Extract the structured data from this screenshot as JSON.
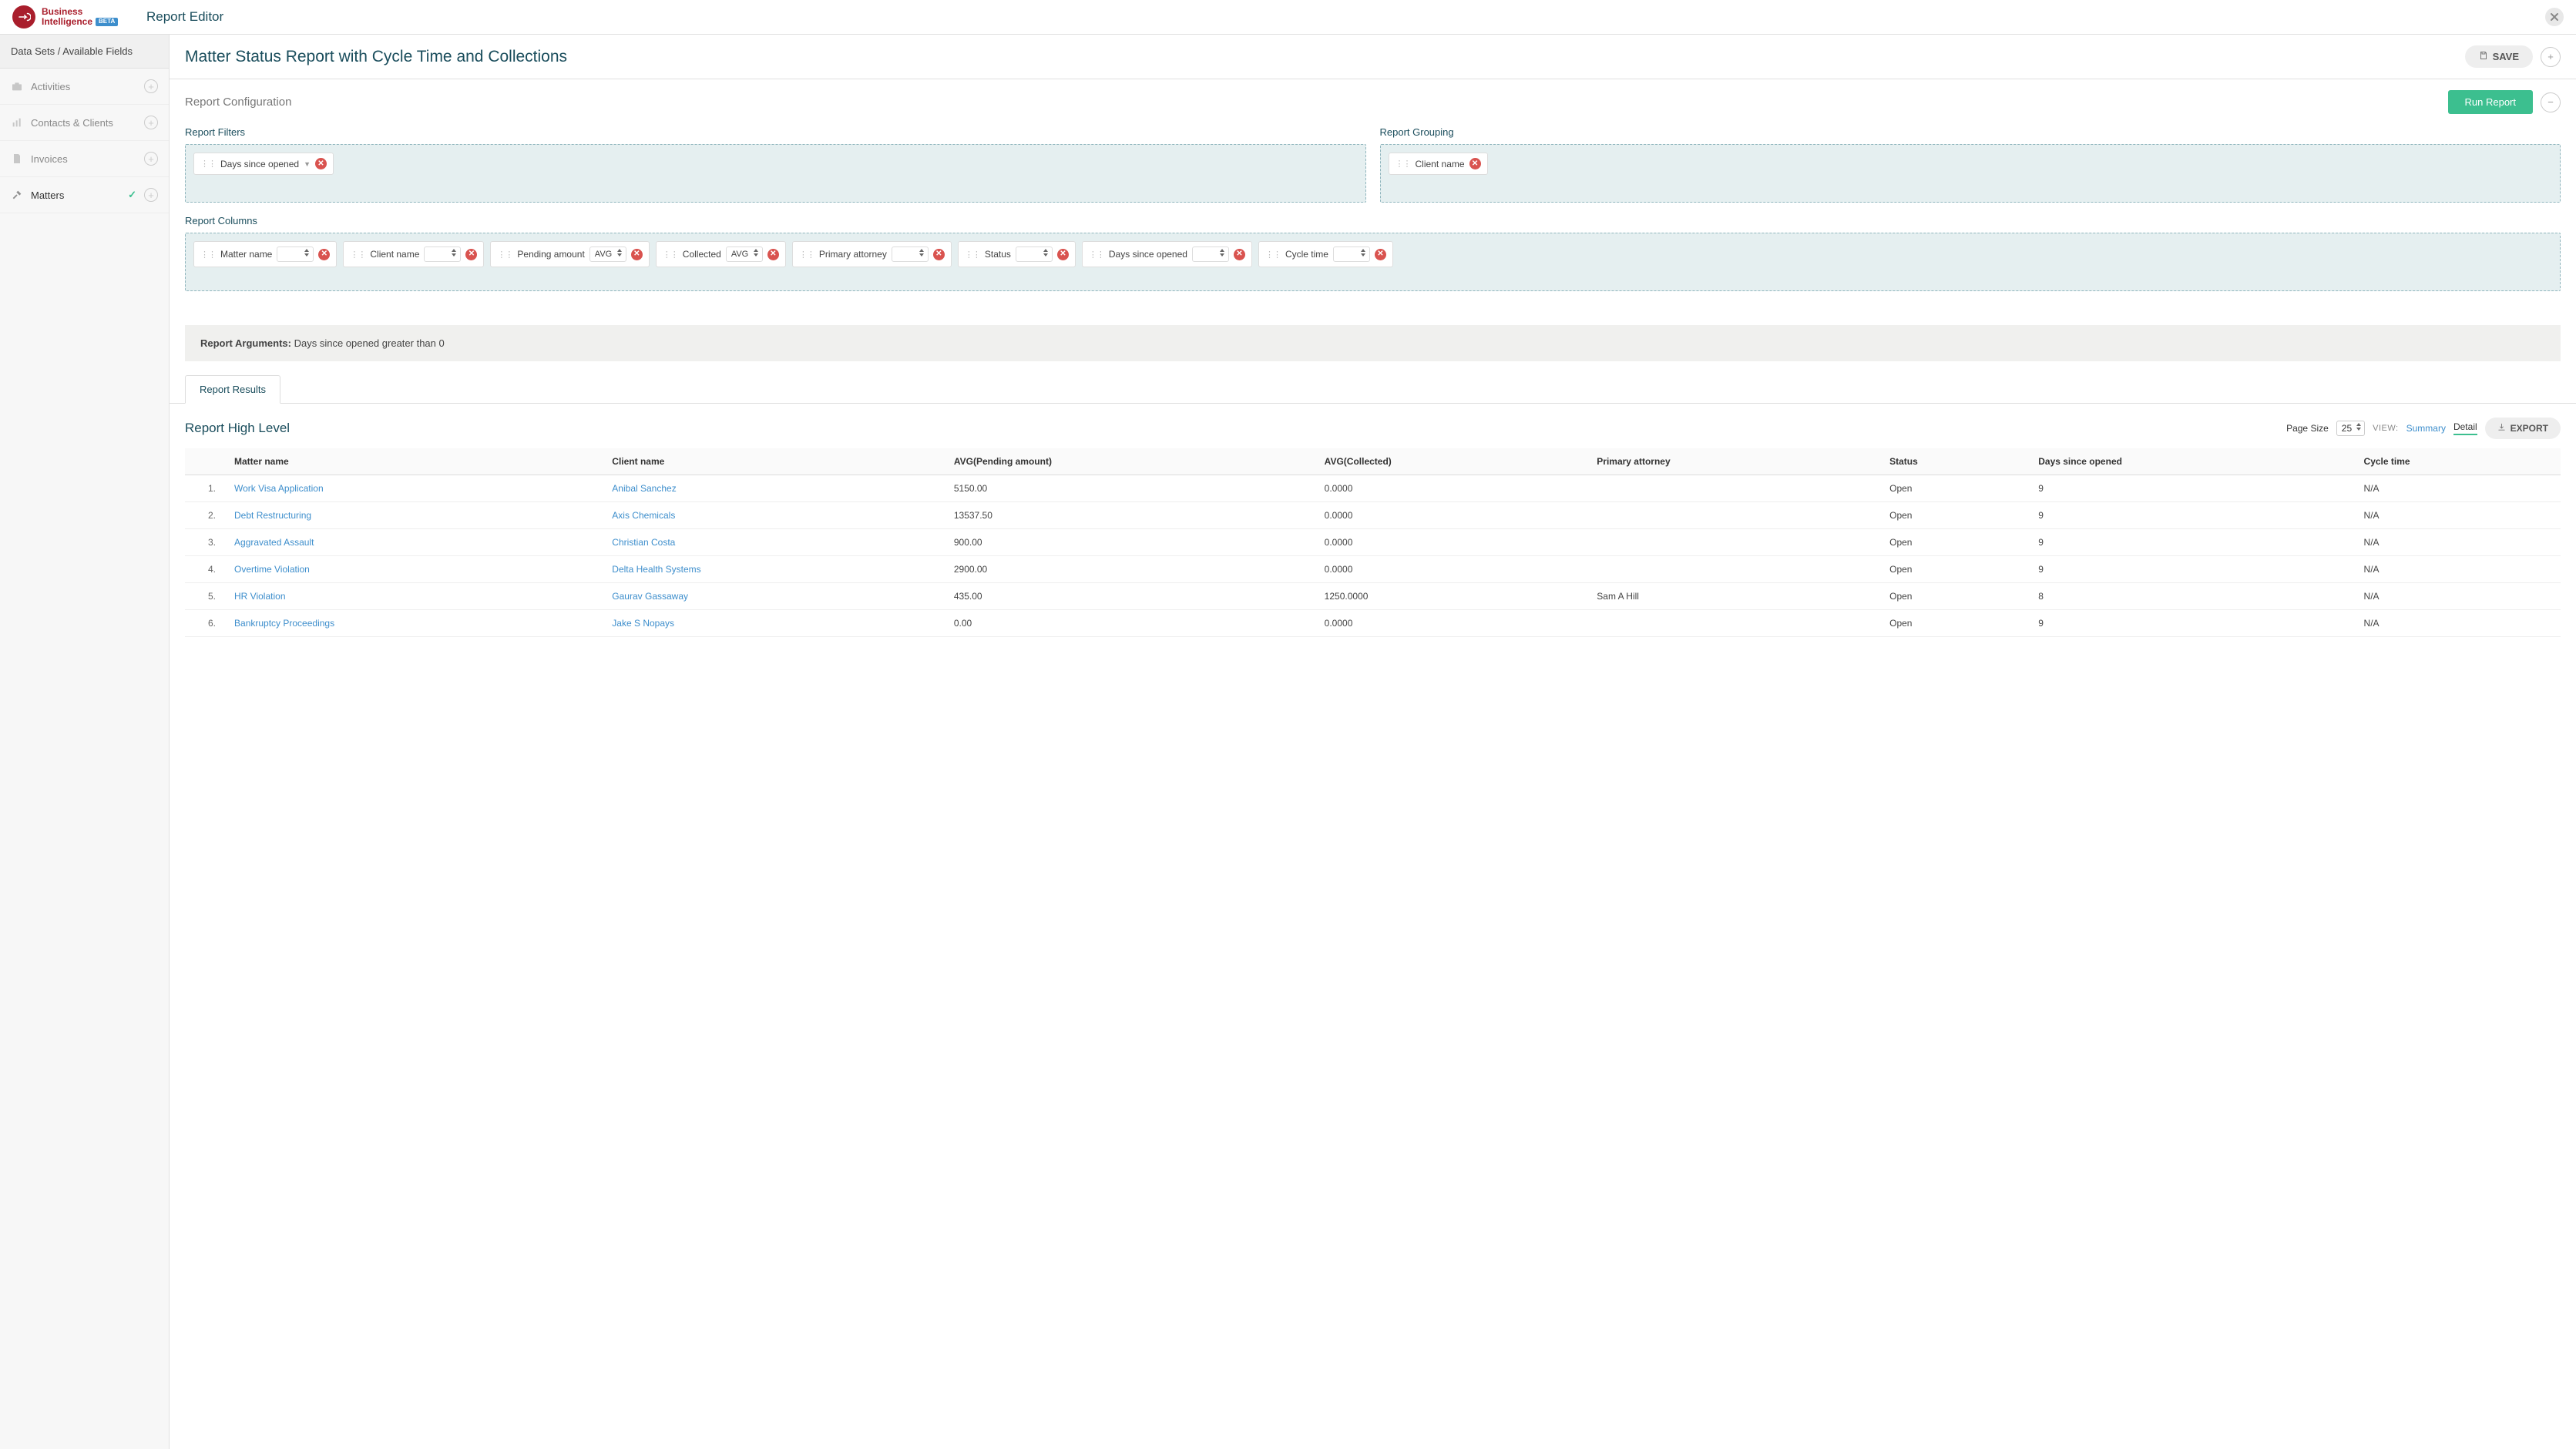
{
  "branding": {
    "line1": "Business",
    "line2": "Intelligence",
    "badge": "BETA"
  },
  "header": {
    "pageTitle": "Report Editor"
  },
  "sidebar": {
    "header": "Data Sets / Available Fields",
    "items": [
      {
        "label": "Activities",
        "active": false
      },
      {
        "label": "Contacts & Clients",
        "active": false
      },
      {
        "label": "Invoices",
        "active": false
      },
      {
        "label": "Matters",
        "active": true
      }
    ]
  },
  "titleRow": {
    "reportTitle": "Matter Status Report with Cycle Time and Collections",
    "saveLabel": "SAVE"
  },
  "config": {
    "heading": "Report Configuration",
    "runLabel": "Run Report",
    "filtersLabel": "Report Filters",
    "groupingLabel": "Report Grouping",
    "columnsLabel": "Report Columns",
    "filters": [
      {
        "label": "Days since opened"
      }
    ],
    "grouping": [
      {
        "label": "Client name"
      }
    ],
    "columns": [
      {
        "label": "Matter name",
        "agg": ""
      },
      {
        "label": "Client name",
        "agg": ""
      },
      {
        "label": "Pending amount",
        "agg": "AVG"
      },
      {
        "label": "Collected",
        "agg": "AVG"
      },
      {
        "label": "Primary attorney",
        "agg": ""
      },
      {
        "label": "Status",
        "agg": ""
      },
      {
        "label": "Days since opened",
        "agg": ""
      },
      {
        "label": "Cycle time",
        "agg": ""
      }
    ]
  },
  "arguments": {
    "label": "Report Arguments:",
    "text": "Days since opened greater than 0"
  },
  "tabs": {
    "results": "Report Results"
  },
  "results": {
    "title": "Report High Level",
    "pageSizeLabel": "Page Size",
    "pageSize": "25",
    "viewLabel": "VIEW:",
    "viewSummary": "Summary",
    "viewDetail": "Detail",
    "exportLabel": "EXPORT",
    "headers": [
      "",
      "Matter name",
      "Client name",
      "AVG(Pending amount)",
      "AVG(Collected)",
      "Primary attorney",
      "Status",
      "Days since opened",
      "Cycle time"
    ],
    "rows": [
      {
        "n": "1.",
        "matter": "Work Visa Application",
        "client": "Anibal Sanchez",
        "pending": "5150.00",
        "collected": "0.0000",
        "attorney": "",
        "status": "Open",
        "days": "9",
        "cycle": "N/A"
      },
      {
        "n": "2.",
        "matter": "Debt Restructuring",
        "client": "Axis Chemicals",
        "pending": "13537.50",
        "collected": "0.0000",
        "attorney": "",
        "status": "Open",
        "days": "9",
        "cycle": "N/A"
      },
      {
        "n": "3.",
        "matter": "Aggravated Assault",
        "client": "Christian Costa",
        "pending": "900.00",
        "collected": "0.0000",
        "attorney": "",
        "status": "Open",
        "days": "9",
        "cycle": "N/A"
      },
      {
        "n": "4.",
        "matter": "Overtime Violation",
        "client": "Delta Health Systems",
        "pending": "2900.00",
        "collected": "0.0000",
        "attorney": "",
        "status": "Open",
        "days": "9",
        "cycle": "N/A"
      },
      {
        "n": "5.",
        "matter": "HR Violation",
        "client": "Gaurav Gassaway",
        "pending": "435.00",
        "collected": "1250.0000",
        "attorney": "Sam A Hill",
        "status": "Open",
        "days": "8",
        "cycle": "N/A"
      },
      {
        "n": "6.",
        "matter": "Bankruptcy Proceedings",
        "client": "Jake S Nopays",
        "pending": "0.00",
        "collected": "0.0000",
        "attorney": "",
        "status": "Open",
        "days": "9",
        "cycle": "N/A"
      }
    ]
  }
}
